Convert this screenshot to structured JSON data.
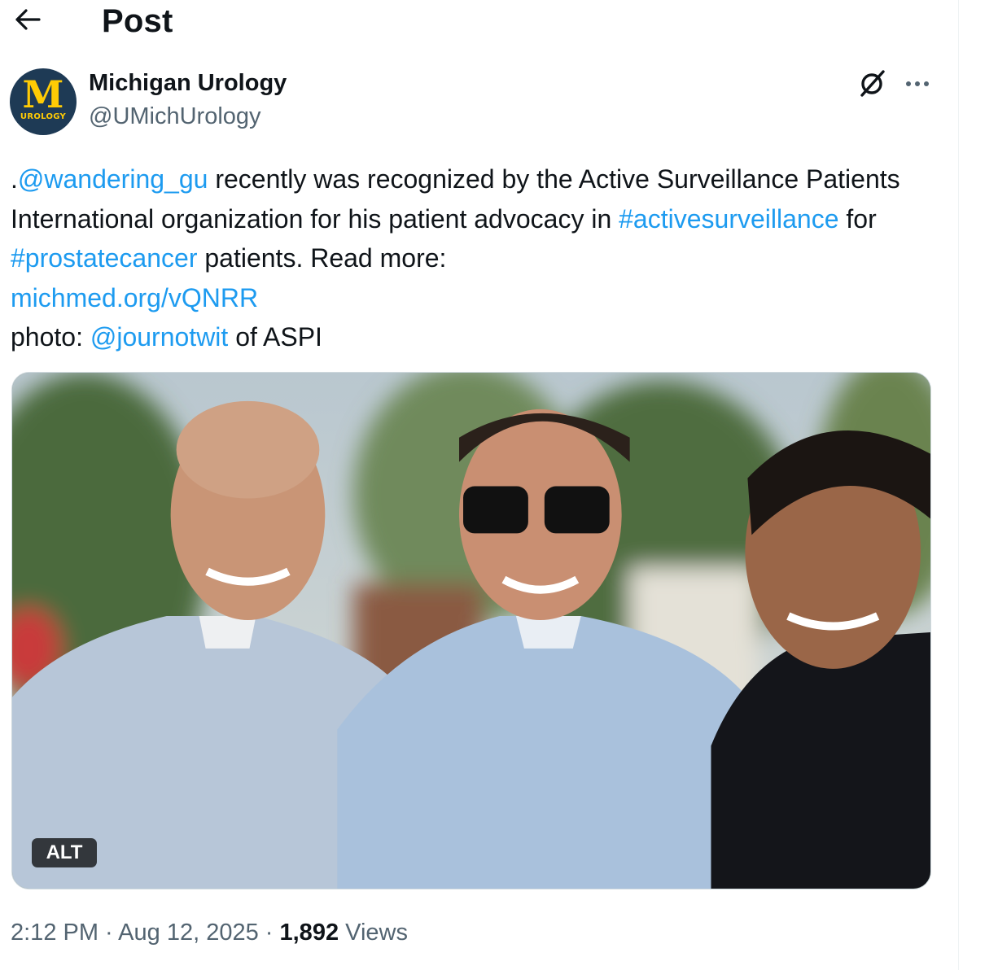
{
  "header": {
    "back_icon": "arrow-left-icon",
    "title": "Post"
  },
  "author": {
    "avatar": {
      "letter": "M",
      "text": "UROLOGY",
      "bg": "#1e3a55",
      "fg": "#ffcb05"
    },
    "display_name": "Michigan Urology",
    "handle": "@UMichUrology"
  },
  "actions": {
    "grok_icon": "grok-icon",
    "more_icon": "more-dots-icon"
  },
  "tweet": {
    "prefix": ".",
    "mention1": "@wandering_gu",
    "text1": " recently was recognized by the Active Surveillance Patients  International organization for his patient advocacy in ",
    "hashtag1": "#activesurveillance",
    "text2": " for ",
    "hashtag2": "#prostatecancer",
    "text3": " patients. Read more: ",
    "link": "michmed.org/vQNRR",
    "photo_prefix": "photo: ",
    "mention2": "@journotwit",
    "photo_suffix": " of ASPI"
  },
  "media": {
    "alt_label": "ALT"
  },
  "meta": {
    "time": "2:12 PM",
    "sep1": " · ",
    "date": "Aug 12, 2025",
    "sep2": " · ",
    "views_count": "1,892",
    "views_label": " Views"
  },
  "colors": {
    "text": "#0f1419",
    "secondary": "#536471",
    "link": "#1d9bf0",
    "border": "#cfd9de"
  }
}
